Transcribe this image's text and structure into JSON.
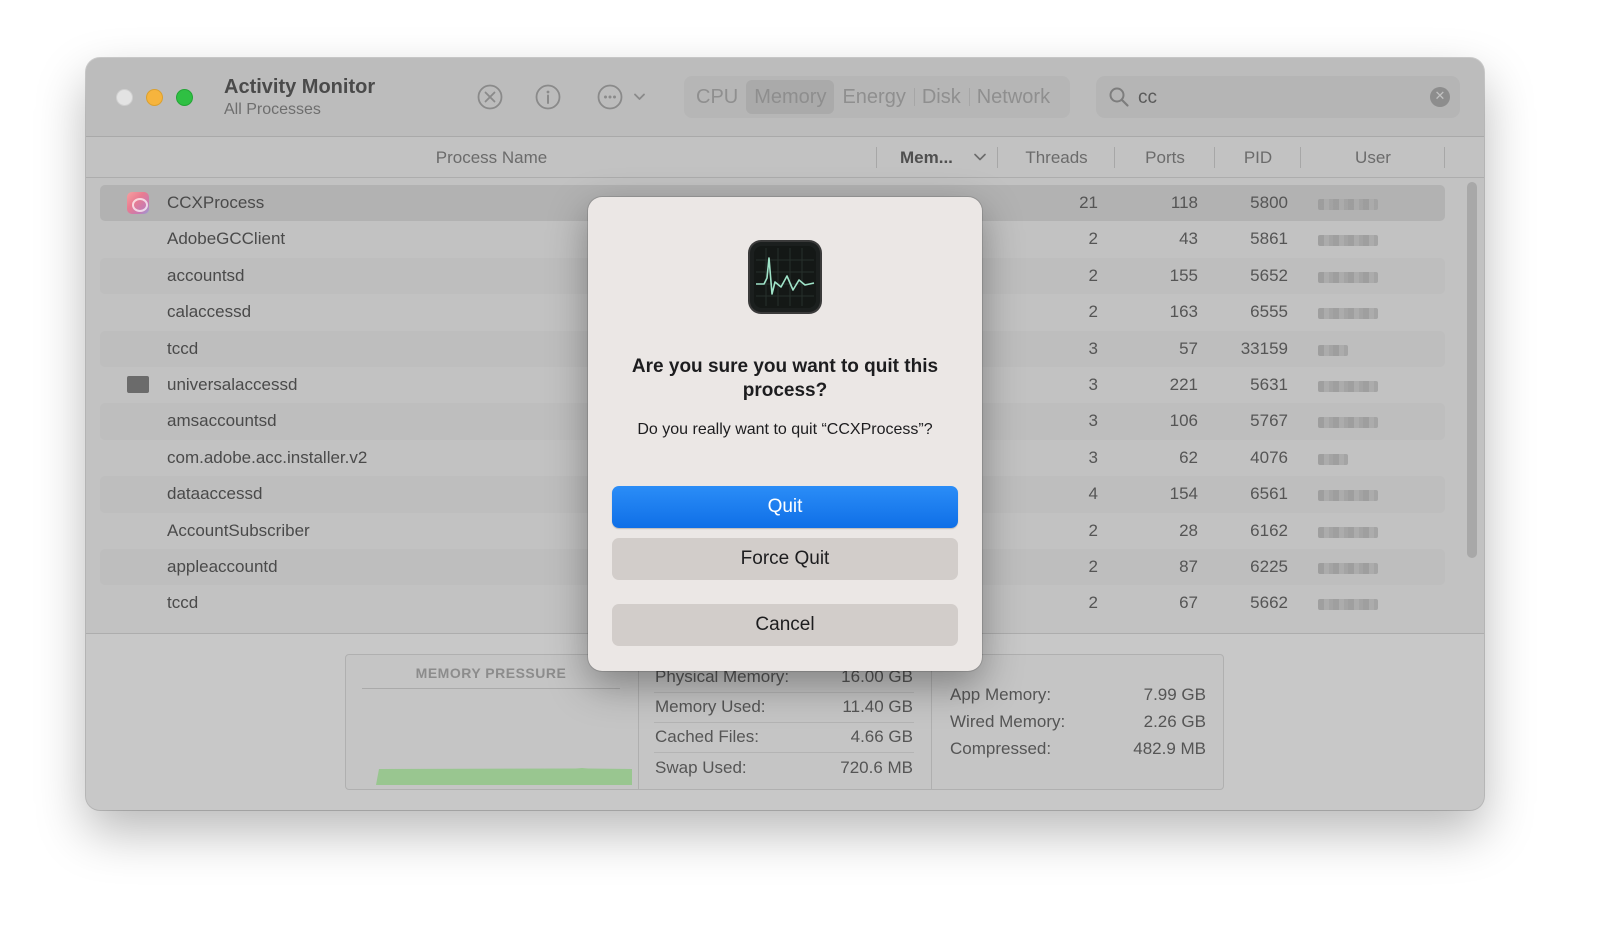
{
  "window": {
    "title": "Activity Monitor",
    "subtitle": "All Processes"
  },
  "toolbar": {
    "stop_icon": "x-circle-icon",
    "info_icon": "info-icon",
    "more_icon": "ellipsis-circle-icon",
    "tabs": [
      {
        "label": "CPU",
        "active": false
      },
      {
        "label": "Memory",
        "active": true
      },
      {
        "label": "Energy",
        "active": false
      },
      {
        "label": "Disk",
        "active": false
      },
      {
        "label": "Network",
        "active": false
      }
    ],
    "search": {
      "value": "cc",
      "icon": "magnifying-glass-icon"
    }
  },
  "table": {
    "columns": {
      "process_name": "Process Name",
      "memory": "Mem...",
      "threads": "Threads",
      "ports": "Ports",
      "pid": "PID",
      "user": "User"
    },
    "sort_column": "memory",
    "rows": [
      {
        "name": "CCXProcess",
        "threads": "21",
        "ports": "118",
        "pid": "5800",
        "icon": "creative-cloud-icon",
        "selected": true
      },
      {
        "name": "AdobeGCClient",
        "threads": "2",
        "ports": "43",
        "pid": "5861"
      },
      {
        "name": "accountsd",
        "threads": "2",
        "ports": "155",
        "pid": "5652"
      },
      {
        "name": "calaccessd",
        "threads": "2",
        "ports": "163",
        "pid": "6555"
      },
      {
        "name": "tccd",
        "threads": "3",
        "ports": "57",
        "pid": "33159"
      },
      {
        "name": "universalaccessd",
        "threads": "3",
        "ports": "221",
        "pid": "5631",
        "icon": "universal-access-icon"
      },
      {
        "name": "amsaccountsd",
        "threads": "3",
        "ports": "106",
        "pid": "5767"
      },
      {
        "name": "com.adobe.acc.installer.v2",
        "threads": "3",
        "ports": "62",
        "pid": "4076"
      },
      {
        "name": "dataaccessd",
        "threads": "4",
        "ports": "154",
        "pid": "6561"
      },
      {
        "name": "AccountSubscriber",
        "threads": "2",
        "ports": "28",
        "pid": "6162"
      },
      {
        "name": "appleaccountd",
        "threads": "2",
        "ports": "87",
        "pid": "6225"
      },
      {
        "name": "tccd",
        "threads": "2",
        "ports": "67",
        "pid": "5662"
      }
    ]
  },
  "memory_summary": {
    "pressure_title": "MEMORY PRESSURE",
    "pressure_color": "#94c58a",
    "stats_left": [
      {
        "label": "Physical Memory:",
        "value": "16.00 GB"
      },
      {
        "label": "Memory Used:",
        "value": "11.40 GB"
      },
      {
        "label": "Cached Files:",
        "value": "4.66 GB"
      },
      {
        "label": "Swap Used:",
        "value": "720.6 MB"
      }
    ],
    "stats_right": [
      {
        "label": "App Memory:",
        "value": "7.99 GB"
      },
      {
        "label": "Wired Memory:",
        "value": "2.26 GB"
      },
      {
        "label": "Compressed:",
        "value": "482.9 MB"
      }
    ]
  },
  "dialog": {
    "icon": "activity-monitor-icon",
    "title": "Are you sure you want to quit this process?",
    "message": "Do you really want to quit “CCXProcess”?",
    "buttons": {
      "quit": "Quit",
      "force_quit": "Force Quit",
      "cancel": "Cancel"
    },
    "accent": "#1a7cf0"
  }
}
